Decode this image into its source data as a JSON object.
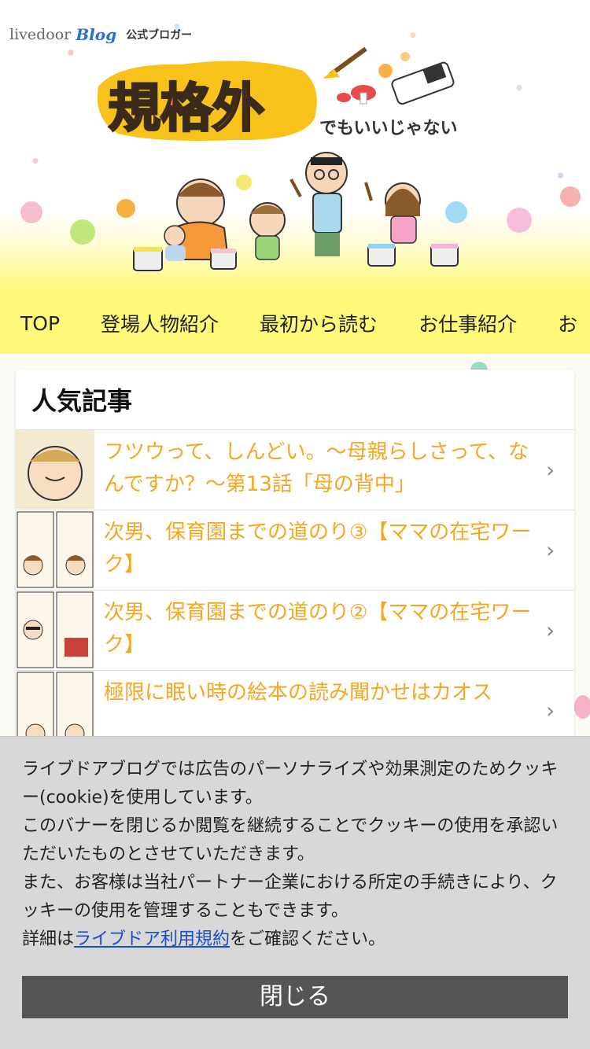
{
  "brand": {
    "livedoor": "livedoor",
    "blog": "Blog",
    "official": "公式ブロガー"
  },
  "logo": {
    "main": "規格外",
    "sub": "でもいいじゃない"
  },
  "nav": {
    "items": [
      "TOP",
      "登場人物紹介",
      "最初から読む",
      "お仕事紹介",
      "お"
    ]
  },
  "popular": {
    "title": "人気記事",
    "articles": [
      {
        "title": "フツウって、しんどい。～母親らしさって、なんですか？～第13話「母の背中」"
      },
      {
        "title": "次男、保育園までの道のり③【ママの在宅ワーク】"
      },
      {
        "title": "次男、保育園までの道のり②【ママの在宅ワーク】"
      },
      {
        "title": "極限に眠い時の絵本の読み聞かせはカオス"
      }
    ]
  },
  "cookie": {
    "line1": "ライブドアブログでは広告のパーソナライズや効果測定のためクッキー(cookie)を使用しています。",
    "line2": "このバナーを閉じるか閲覧を継続することでクッキーの使用を承認いただいたものとさせていただきます。",
    "line3": "また、お客様は当社パートナー企業における所定の手続きにより、クッキーの使用を管理することもできます。",
    "detail_prefix": "詳細は",
    "terms_link": "ライブドア利用規約",
    "detail_suffix": "をご確認ください。",
    "close_label": "閉じる"
  },
  "colors": {
    "accent_yellow": "#fff97a",
    "article_title": "#f5a623",
    "link_blue": "#1a4fc4",
    "button_gray": "#555555"
  }
}
